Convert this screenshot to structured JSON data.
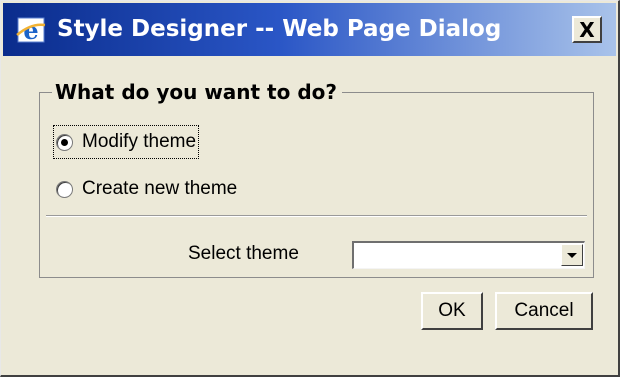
{
  "window": {
    "title": "Style Designer -- Web Page Dialog",
    "close_glyph": "X",
    "title_icon": "internet-explorer-icon"
  },
  "group": {
    "legend": "What do you want to do?",
    "options": [
      {
        "label": "Modify theme",
        "selected": true
      },
      {
        "label": "Create new theme",
        "selected": false
      }
    ]
  },
  "select_theme": {
    "label": "Select theme",
    "value": ""
  },
  "buttons": {
    "ok": "OK",
    "cancel": "Cancel"
  },
  "colors": {
    "dialog_bg": "#ece9d8",
    "title_start": "#0a2c8c",
    "title_end": "#a9c3ea"
  }
}
